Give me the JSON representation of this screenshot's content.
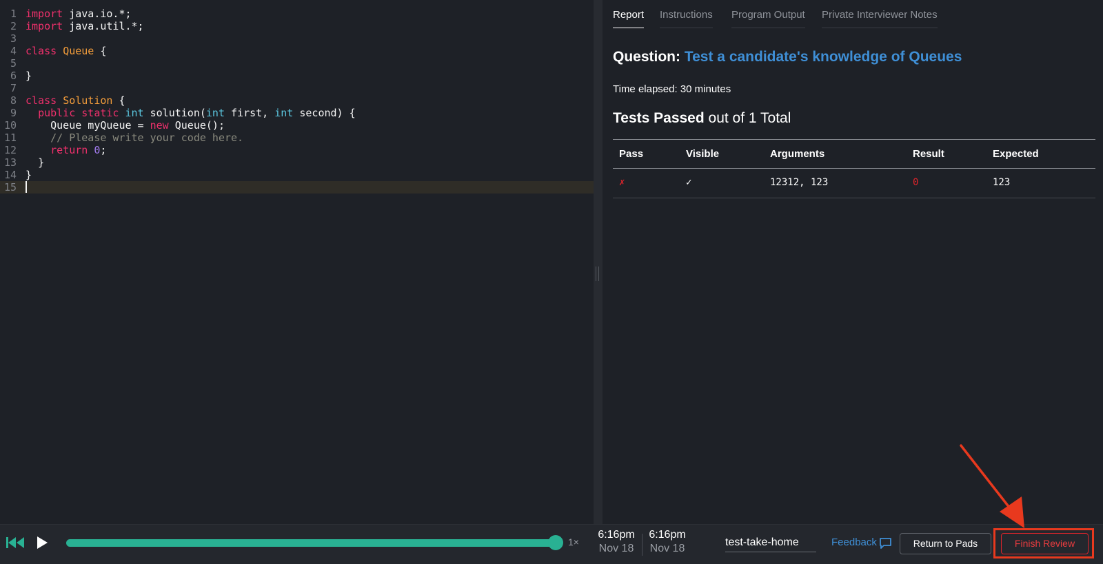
{
  "editor": {
    "lines": [
      {
        "n": "1"
      },
      {
        "n": "2"
      },
      {
        "n": "3"
      },
      {
        "n": "4"
      },
      {
        "n": "5"
      },
      {
        "n": "6"
      },
      {
        "n": "7"
      },
      {
        "n": "8"
      },
      {
        "n": "9"
      },
      {
        "n": "10"
      },
      {
        "n": "11"
      },
      {
        "n": "12"
      },
      {
        "n": "13"
      },
      {
        "n": "14"
      },
      {
        "n": "15"
      }
    ],
    "tok": {
      "import": "import",
      "java_io": " java.io.*;",
      "java_util": " java.util.*;",
      "class": "class",
      "queue_name": "Queue",
      "open_brace": " {",
      "close_brace": "}",
      "solution_name": "Solution",
      "indent2": "  ",
      "indent4": "    ",
      "public": "public",
      "static": "static",
      "int": "int",
      "sol_sig1": " solution(",
      "first_param": " first, ",
      "second_param": " second) {",
      "queue_decl": "Queue myQueue = ",
      "new": "new",
      "queue_ctor": " Queue();",
      "comment": "// Please write your code here.",
      "return": "return",
      "zero": "0",
      "semicolon": ";",
      "space": " "
    }
  },
  "panel": {
    "tabs": [
      {
        "label": "Report"
      },
      {
        "label": "Instructions"
      },
      {
        "label": "Program Output"
      },
      {
        "label": "Private Interviewer Notes"
      }
    ],
    "question_prefix": "Question:",
    "question_title": "Test a candidate's knowledge of Queues",
    "time_elapsed": "Time elapsed: 30 minutes",
    "tests_passed_bold": "Tests Passed",
    "tests_passed_rest": "out of 1 Total",
    "table": {
      "headers": [
        "Pass",
        "Visible",
        "Arguments",
        "Result",
        "Expected"
      ],
      "rows": [
        {
          "pass": "✗",
          "visible": "✓",
          "arguments": "12312, 123",
          "result": "0",
          "expected": "123"
        }
      ]
    }
  },
  "player": {
    "progress_percent": 100,
    "speed": "1×",
    "start_time": "6:16pm",
    "start_date": "Nov 18",
    "end_time": "6:16pm",
    "end_date": "Nov 18",
    "pad_name": "test-take-home",
    "feedback_label": "Feedback",
    "return_label": "Return to Pads",
    "finish_label": "Finish Review"
  },
  "colors": {
    "accent": "#29b193",
    "link": "#3f8fd6",
    "danger": "#e0242b",
    "annotation": "#e8391e"
  },
  "icons": [
    "rewind-icon",
    "play-icon",
    "feedback-chat-icon",
    "annotation-arrow"
  ]
}
